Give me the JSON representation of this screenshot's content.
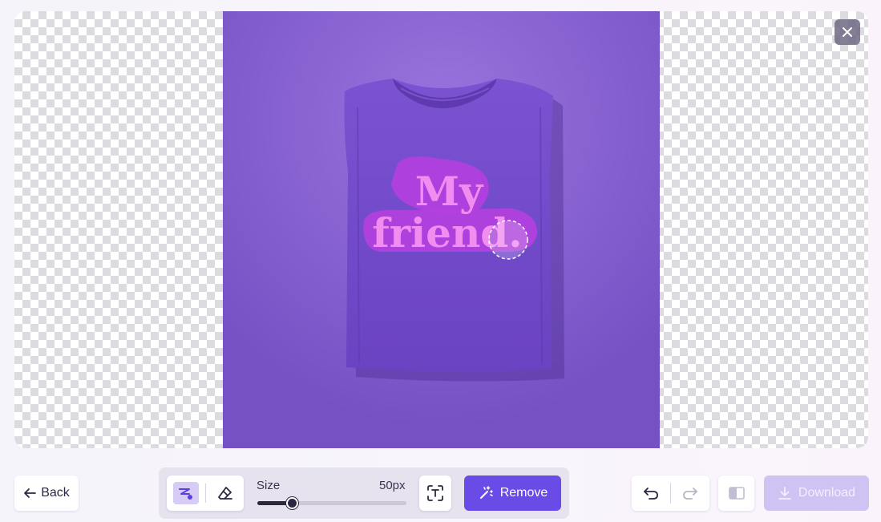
{
  "canvas": {
    "image_alt": "Purple t-shirt with My friend. print",
    "shirt_text_line1": "My",
    "shirt_text_line2": "friend."
  },
  "close_button": {
    "icon": "close-icon"
  },
  "toolbar": {
    "back_label": "Back",
    "brush_size": {
      "label": "Size",
      "value": "50px",
      "fraction": 0.23
    },
    "remove_label": "Remove",
    "download_label": "Download"
  },
  "colors": {
    "accent": "#6a4be8",
    "download_disabled": "#cfc3f3",
    "background_purple": "#8060cc",
    "shirt": "#6f46c8",
    "print_pink": "#e86ee8"
  }
}
